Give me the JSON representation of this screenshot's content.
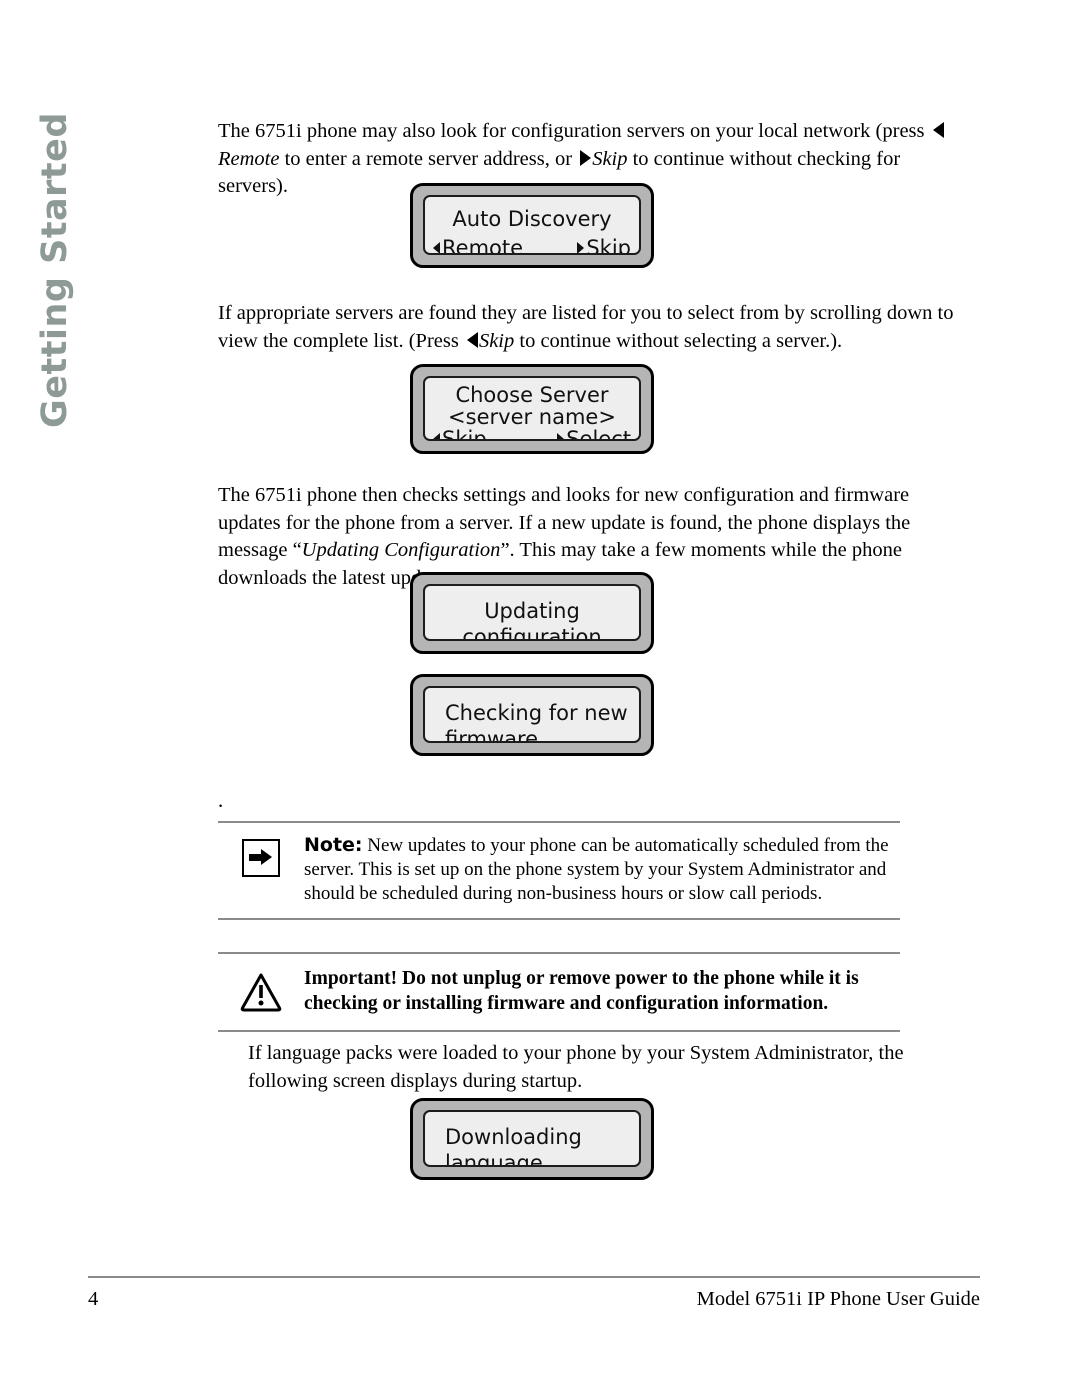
{
  "side_tab": {
    "label": "Getting Started",
    "color": "#8e9a95"
  },
  "paragraphs": {
    "p1_part1": "The 6751i phone may also look for configuration servers on your local network (press ",
    "p1_remote": "Remote",
    "p1_part2": " to enter a remote server address, or ",
    "p1_skip": "Skip",
    "p1_part3": " to continue without checking for servers).",
    "p2_part1": "If appropriate servers are found they are listed for you to select from by scrolling down to view the complete list. (Press ",
    "p2_skip": "Skip",
    "p2_part2": " to continue without selecting a server.).",
    "p3_part1": "The 6751i phone then checks settings and looks for new configuration and firmware updates for the phone from a server. If a new update is found, the phone displays the message “",
    "p3_italic": "Updating Configuration",
    "p3_part2": "”. This may take a few moments while the phone downloads the latest updates",
    "p4": "If language packs were loaded to your phone by your System Administrator, the following screen displays during startup.",
    "stray_dot": "."
  },
  "lcd_screens": {
    "auto_discovery": {
      "title": "Auto Discovery",
      "softkey_left": "Remote",
      "softkey_right": "Skip"
    },
    "choose_server": {
      "title": "Choose Server",
      "subtitle": "<server name>",
      "softkey_left": "Skip",
      "softkey_right": "Select"
    },
    "updating_config": {
      "line1": "Updating",
      "line2": "configuration"
    },
    "checking_firmware": {
      "line1": "Checking for new",
      "line2": "firmware......"
    },
    "downloading": {
      "line1": "Downloading",
      "line2": "language packs....."
    }
  },
  "callouts": {
    "note": {
      "icon": "arrow-right-box-icon",
      "label": "Note:",
      "text": " New updates to your phone can be automatically scheduled from the server. This is set up on the phone system by your System Administrator and should be scheduled during non-business hours or slow call periods."
    },
    "important": {
      "icon": "warning-triangle-icon",
      "text": "Important! Do not unplug or remove power to the phone while it is checking or installing firmware and configuration information."
    }
  },
  "footer": {
    "page_number": "4",
    "title": "Model 6751i IP Phone User Guide"
  },
  "colors": {
    "rule": "#8b8b8b",
    "lcd_bezel": "#b5b5b5",
    "lcd_screen": "#eeeeee",
    "side_tab_text": "#8e9a95"
  }
}
